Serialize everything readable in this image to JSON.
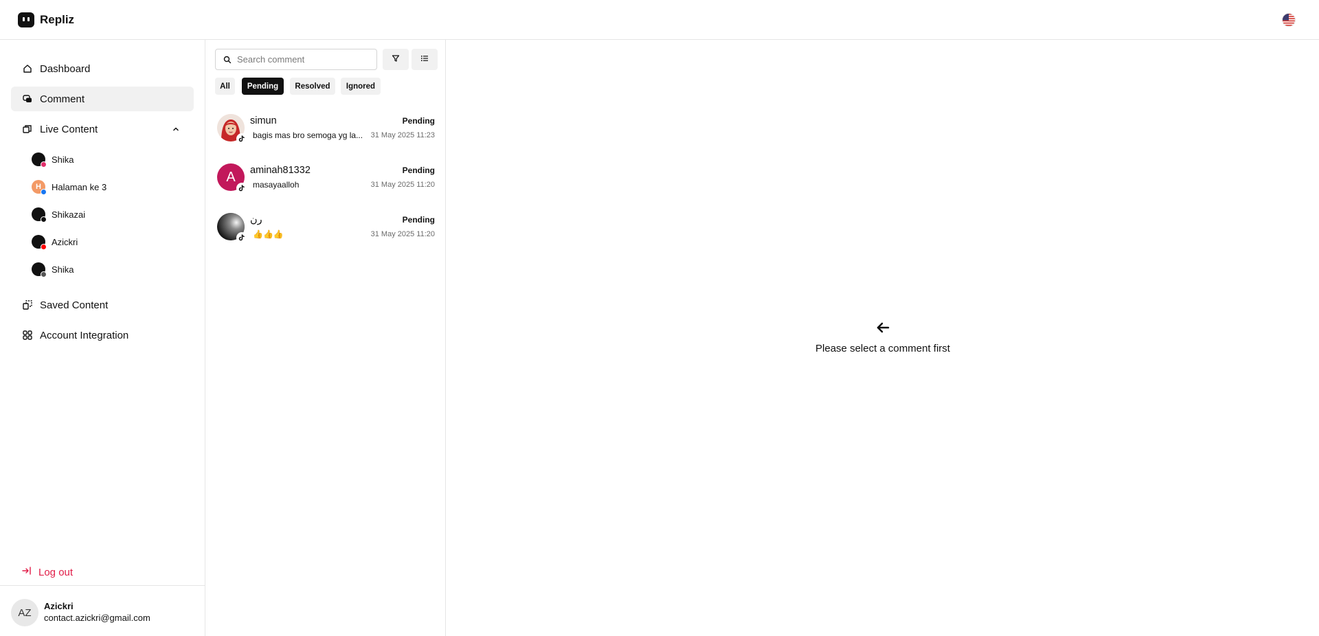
{
  "brand": {
    "name": "Repliz"
  },
  "header": {
    "language_flag": "us-flag-icon"
  },
  "sidebar": {
    "nav": {
      "dashboard": "Dashboard",
      "comment": "Comment",
      "live_content": "Live Content",
      "saved_content": "Saved Content",
      "account_integration": "Account Integration"
    },
    "live_content_items": [
      {
        "label": "Shika",
        "avatar_letter": "",
        "platform": "instagram",
        "badge_color": "#e1306c"
      },
      {
        "label": "Halaman ke 3",
        "avatar_letter": "H",
        "platform": "facebook",
        "badge_color": "#1877f2"
      },
      {
        "label": "Shikazai",
        "avatar_letter": "",
        "platform": "tiktok",
        "badge_color": "#111111"
      },
      {
        "label": "Azickri",
        "avatar_letter": "",
        "platform": "youtube",
        "badge_color": "#ff0000"
      },
      {
        "label": "Shika",
        "avatar_letter": "",
        "platform": "threads",
        "badge_color": "#555555"
      }
    ],
    "logout": "Log out",
    "user": {
      "initials": "AZ",
      "name": "Azickri",
      "email": "contact.azickri@gmail.com"
    }
  },
  "comments_panel": {
    "search_placeholder": "Search comment",
    "filters": [
      "All",
      "Pending",
      "Resolved",
      "Ignored"
    ],
    "active_filter": "Pending",
    "items": [
      {
        "name": "simun",
        "text": "bagis mas bro semoga yg la...",
        "status": "Pending",
        "date": "31 May 2025 11:23",
        "avatar": "photo-avatar",
        "platform": "tiktok"
      },
      {
        "name": "aminah81332",
        "text": "masayaalloh",
        "status": "Pending",
        "date": "31 May 2025 11:20",
        "avatar_letter": "A",
        "avatar_color": "#c2185b",
        "platform": "tiktok"
      },
      {
        "name": "رن",
        "text": "👍👍👍",
        "status": "Pending",
        "date": "31 May 2025 11:20",
        "avatar": "photo-avatar",
        "platform": "tiktok"
      }
    ]
  },
  "empty_state": {
    "message": "Please select a comment first",
    "icon": "arrow-left-icon"
  },
  "colors": {
    "accent_dark": "#111111",
    "logout_red": "#e11d48",
    "active_bg": "#f1f1f1"
  }
}
